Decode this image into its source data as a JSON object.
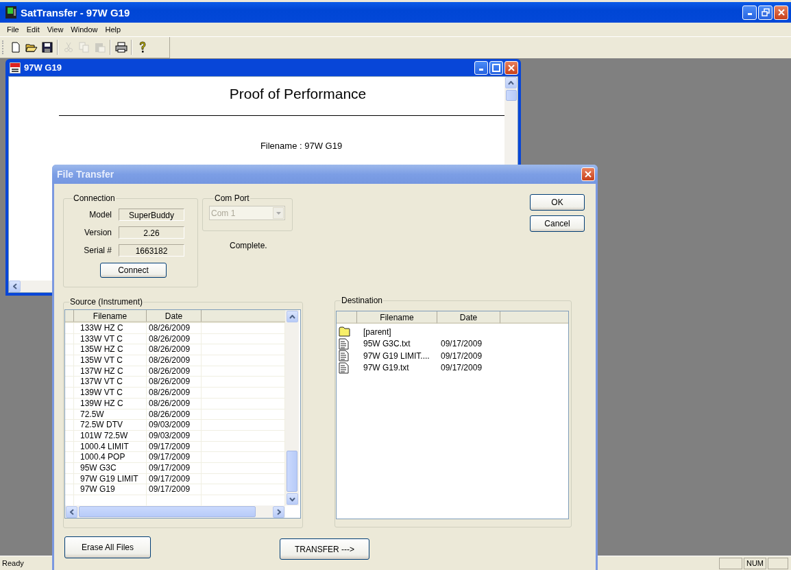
{
  "app": {
    "title": "SatTransfer - 97W G19"
  },
  "menu": [
    "File",
    "Edit",
    "View",
    "Window",
    "Help"
  ],
  "toolbar": [
    [
      {
        "kind": "new",
        "disabled": false
      },
      {
        "kind": "open",
        "disabled": false
      },
      {
        "kind": "save",
        "disabled": false
      }
    ],
    [
      {
        "kind": "cut",
        "disabled": true
      },
      {
        "kind": "copy",
        "disabled": true
      },
      {
        "kind": "paste",
        "disabled": true
      }
    ],
    [
      {
        "kind": "print",
        "disabled": false
      }
    ],
    [
      {
        "kind": "help",
        "disabled": false
      }
    ]
  ],
  "document_window": {
    "title": "97W G19",
    "heading": "Proof of Performance",
    "filename_line": "Filename : 97W G19"
  },
  "dialog": {
    "title": "File Transfer",
    "connection": {
      "label": "Connection",
      "fields": [
        {
          "label": "Model",
          "value": "SuperBuddy"
        },
        {
          "label": "Version",
          "value": "2.26"
        },
        {
          "label": "Serial #",
          "value": "1663182"
        }
      ],
      "button": "Connect"
    },
    "com_port": {
      "label": "Com Port",
      "value": "Com 1",
      "disabled": true
    },
    "status": "Complete.",
    "buttons": [
      "OK",
      "Cancel"
    ],
    "source": {
      "label": "Source (Instrument)",
      "columns": [
        "Filename",
        "Date"
      ],
      "rows": [
        {
          "filename": "133W HZ C",
          "date": "08/26/2009"
        },
        {
          "filename": "133W VT C",
          "date": "08/26/2009"
        },
        {
          "filename": "135W HZ C",
          "date": "08/26/2009"
        },
        {
          "filename": "135W VT C",
          "date": "08/26/2009"
        },
        {
          "filename": "137W HZ C",
          "date": "08/26/2009"
        },
        {
          "filename": "137W VT C",
          "date": "08/26/2009"
        },
        {
          "filename": "139W VT C",
          "date": "08/26/2009"
        },
        {
          "filename": "139W HZ C",
          "date": "08/26/2009"
        },
        {
          "filename": "72.5W",
          "date": "08/26/2009"
        },
        {
          "filename": "72.5W DTV",
          "date": "09/03/2009"
        },
        {
          "filename": "101W 72.5W",
          "date": "09/03/2009"
        },
        {
          "filename": "1000.4 LIMIT",
          "date": "09/17/2009"
        },
        {
          "filename": "1000.4 POP",
          "date": "09/17/2009"
        },
        {
          "filename": "95W G3C",
          "date": "09/17/2009"
        },
        {
          "filename": "97W G19 LIMIT",
          "date": "09/17/2009"
        },
        {
          "filename": "97W G19",
          "date": "09/17/2009"
        }
      ]
    },
    "destination": {
      "label": "Destination",
      "columns": [
        "Filename",
        "Date"
      ],
      "rows": [
        {
          "kind": "folder",
          "filename": "[parent]"
        },
        {
          "kind": "file",
          "filename": "95W G3C.txt",
          "date": "09/17/2009"
        },
        {
          "kind": "file",
          "filename": "97W G19 LIMIT....",
          "date": "09/17/2009"
        },
        {
          "kind": "file",
          "filename": "97W G19.txt",
          "date": "09/17/2009"
        }
      ]
    },
    "erase_button": "Erase All Files",
    "transfer_button": "TRANSFER --->"
  },
  "status_bar": {
    "text": "Ready",
    "indicator": "NUM"
  }
}
